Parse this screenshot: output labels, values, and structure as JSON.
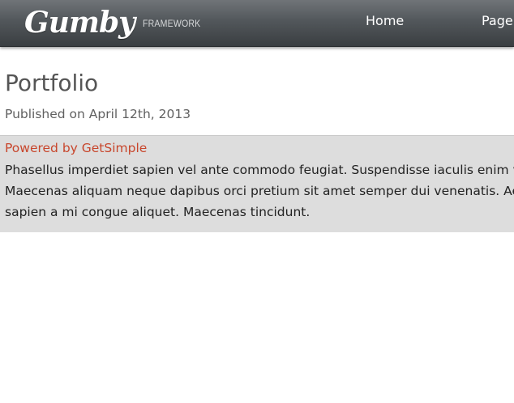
{
  "header": {
    "logo_text": "Gumby",
    "logo_subtext": "FRAMEWORK",
    "nav": [
      {
        "label": "Home"
      },
      {
        "label": "Page"
      }
    ]
  },
  "post": {
    "title": "Portfolio",
    "published": "Published on April 12th, 2013",
    "powered_link": "Powered by GetSimple",
    "body_lines": [
      "Phasellus imperdiet sapien vel ante commodo feugiat. Suspendisse iaculis enim vitae",
      "Maecenas aliquam neque dapibus orci pretium sit amet semper dui venenatis. Aenean",
      "sapien a mi congue aliquet. Maecenas tincidunt."
    ]
  },
  "colors": {
    "navbar": "#52575b",
    "link_accent": "#c8462c",
    "content_background": "#dddddd"
  }
}
